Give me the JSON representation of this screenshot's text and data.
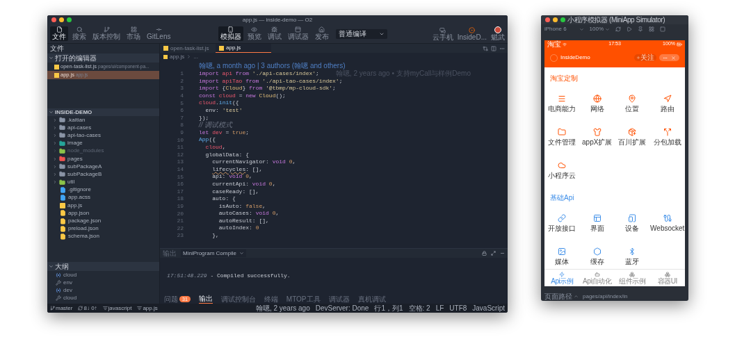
{
  "ide": {
    "title": "app.js — inside-demo — O2",
    "toolbar_left": [
      {
        "label": "文件",
        "selected": true
      },
      {
        "label": "搜索",
        "selected": false
      },
      {
        "label": "版本控制",
        "selected": false
      },
      {
        "label": "市场",
        "selected": false
      },
      {
        "label": "GitLens",
        "selected": false
      }
    ],
    "toolbar_center": [
      {
        "label": "模拟器",
        "selected": true
      },
      {
        "label": "预览",
        "selected": false
      },
      {
        "label": "调试",
        "selected": false
      },
      {
        "label": "调试器",
        "selected": false
      },
      {
        "label": "发布",
        "selected": false
      }
    ],
    "compile_mode": "普通编译",
    "toolbar_right": [
      {
        "label": "云手机"
      },
      {
        "label": "InsideD..."
      },
      {
        "label": "魈武"
      }
    ],
    "sidebar": {
      "title": "文件",
      "open_editors": {
        "title": "打开的编辑器",
        "expanded": true,
        "items": [
          {
            "name": "open-task-list.js",
            "path": "pages/ui/component-pa...",
            "selected": false
          },
          {
            "name": "app.js",
            "path": "app.js",
            "selected": true
          }
        ]
      },
      "project": {
        "title": "INSIDE-DEMO",
        "expanded": true,
        "items": [
          {
            "name": ".kaitian",
            "kind": "folder",
            "color": "#8a94a6",
            "ignored": false
          },
          {
            "name": "api-cases",
            "kind": "folder",
            "color": "#8a94a6",
            "ignored": false
          },
          {
            "name": "api-tao-cases",
            "kind": "folder",
            "color": "#8a94a6",
            "ignored": false
          },
          {
            "name": "image",
            "kind": "folder",
            "color": "#26a69a",
            "ignored": false
          },
          {
            "name": "node_modules",
            "kind": "folder",
            "color": "#8bc34a",
            "ignored": true
          },
          {
            "name": "pages",
            "kind": "folder",
            "color": "#ef5350",
            "ignored": false
          },
          {
            "name": "subPackageA",
            "kind": "folder",
            "color": "#8a94a6",
            "ignored": false
          },
          {
            "name": "subPackageB",
            "kind": "folder",
            "color": "#8a94a6",
            "ignored": false
          },
          {
            "name": "util",
            "kind": "folder",
            "color": "#8bc34a",
            "ignored": false
          },
          {
            "name": ".gitignore",
            "kind": "git",
            "color": "#42a5f5",
            "ignored": false
          },
          {
            "name": "app.acss",
            "kind": "css",
            "color": "#42a5f5",
            "ignored": false
          },
          {
            "name": "app.js",
            "kind": "js",
            "color": "#f9c846",
            "ignored": false
          },
          {
            "name": "app.json",
            "kind": "json",
            "color": "#f9c846",
            "ignored": false
          },
          {
            "name": "package.json",
            "kind": "json",
            "color": "#f9c846",
            "ignored": false
          },
          {
            "name": "preload.json",
            "kind": "json",
            "color": "#f9c846",
            "ignored": false
          },
          {
            "name": "schema.json",
            "kind": "json",
            "color": "#f9c846",
            "ignored": false
          }
        ]
      },
      "outline": {
        "title": "大纲",
        "expanded": true,
        "items": [
          {
            "name": "cloud",
            "kind": "variable"
          },
          {
            "name": "env",
            "kind": "property"
          },
          {
            "name": "dev",
            "kind": "variable"
          },
          {
            "name": "cloud",
            "kind": "property"
          }
        ]
      }
    },
    "editor": {
      "tabs": [
        {
          "label": "open-task-list.js",
          "selected": false
        },
        {
          "label": "app.js",
          "selected": true
        }
      ],
      "breadcrumb": [
        "app.js",
        "..."
      ],
      "blame": "翰嗯, a month ago | 3 authors (翰嗯 and others)",
      "inline_blame": "翰嗯, 2 years ago • 支持myCall与样例Demo",
      "lines": [
        {
          "n": "1",
          "tokens": [
            {
              "kind": "kw",
              "text": "import "
            },
            {
              "kind": "var",
              "text": "api "
            },
            {
              "kind": "kw",
              "text": "from "
            },
            {
              "kind": "str",
              "text": "'./api-cases/index'"
            },
            {
              "kind": "p",
              "text": ";"
            }
          ]
        },
        {
          "n": "2",
          "tokens": [
            {
              "kind": "kw",
              "text": "import "
            },
            {
              "kind": "var",
              "text": "apiTao "
            },
            {
              "kind": "kw",
              "text": "from "
            },
            {
              "kind": "str",
              "text": "'./api-tao-cases/index'"
            },
            {
              "kind": "p",
              "text": ";"
            }
          ]
        },
        {
          "n": "3",
          "tokens": [
            {
              "kind": "kw",
              "text": "import "
            },
            {
              "kind": "p",
              "text": "{"
            },
            {
              "kind": "cls",
              "text": "Cloud"
            },
            {
              "kind": "p",
              "text": "} "
            },
            {
              "kind": "kw",
              "text": "from "
            },
            {
              "kind": "str",
              "text": "'@tbmp/mp-cloud-sdk'"
            },
            {
              "kind": "p",
              "text": ";"
            }
          ]
        },
        {
          "n": "4",
          "tokens": [
            {
              "kind": "kw",
              "text": "const "
            },
            {
              "kind": "var",
              "text": "cloud "
            },
            {
              "kind": "p",
              "text": "= "
            },
            {
              "kind": "kw",
              "text": "new "
            },
            {
              "kind": "cls",
              "text": "Cloud"
            },
            {
              "kind": "p",
              "text": "();"
            }
          ]
        },
        {
          "n": "5",
          "tokens": [
            {
              "kind": "var",
              "text": "cloud"
            },
            {
              "kind": "p",
              "text": "."
            },
            {
              "kind": "fn",
              "text": "init"
            },
            {
              "kind": "p",
              "text": "({"
            }
          ]
        },
        {
          "n": "6",
          "tokens": [
            {
              "kind": "p",
              "text": "  env: "
            },
            {
              "kind": "str",
              "text": "'test'"
            }
          ]
        },
        {
          "n": "7",
          "tokens": [
            {
              "kind": "p",
              "text": "});"
            }
          ]
        },
        {
          "n": "8",
          "tokens": [
            {
              "kind": "cm",
              "text": "// 调试模式"
            }
          ]
        },
        {
          "n": "9",
          "tokens": [
            {
              "kind": "kw",
              "text": "let "
            },
            {
              "kind": "var",
              "text": "dev "
            },
            {
              "kind": "p",
              "text": "= "
            },
            {
              "kind": "bool",
              "text": "true"
            },
            {
              "kind": "p",
              "text": ";"
            }
          ]
        },
        {
          "n": "10",
          "tokens": [
            {
              "kind": "fn",
              "text": "App"
            },
            {
              "kind": "p",
              "text": "({"
            }
          ]
        },
        {
          "n": "11",
          "tokens": [
            {
              "kind": "var",
              "text": "  cloud"
            },
            {
              "kind": "p",
              "text": ","
            }
          ]
        },
        {
          "n": "12",
          "tokens": [
            {
              "kind": "p",
              "text": "  globalData: {"
            }
          ]
        },
        {
          "n": "13",
          "tokens": [
            {
              "kind": "p",
              "text": "    currentNavigator: "
            },
            {
              "kind": "kw",
              "text": "void "
            },
            {
              "kind": "num",
              "text": "0"
            },
            {
              "kind": "p",
              "text": ","
            }
          ]
        },
        {
          "n": "14",
          "tokens": [
            {
              "kind": "warn",
              "text": "    lifecycles"
            },
            {
              "kind": "p",
              "text": ": [],"
            }
          ]
        },
        {
          "n": "15",
          "tokens": [
            {
              "kind": "p",
              "text": "    api: "
            },
            {
              "kind": "kw",
              "text": "void "
            },
            {
              "kind": "num",
              "text": "0"
            },
            {
              "kind": "p",
              "text": ","
            }
          ]
        },
        {
          "n": "16",
          "tokens": [
            {
              "kind": "p",
              "text": "    currentApi: "
            },
            {
              "kind": "kw",
              "text": "void "
            },
            {
              "kind": "num",
              "text": "0"
            },
            {
              "kind": "p",
              "text": ","
            }
          ]
        },
        {
          "n": "17",
          "tokens": [
            {
              "kind": "p",
              "text": "    caseReady: [],"
            }
          ]
        },
        {
          "n": "18",
          "tokens": [
            {
              "kind": "p",
              "text": "    auto: {"
            }
          ]
        },
        {
          "n": "19",
          "tokens": [
            {
              "kind": "p",
              "text": "      isAuto: "
            },
            {
              "kind": "bool",
              "text": "false"
            },
            {
              "kind": "p",
              "text": ","
            }
          ]
        },
        {
          "n": "20",
          "tokens": [
            {
              "kind": "p",
              "text": "      autoCases: "
            },
            {
              "kind": "kw",
              "text": "void "
            },
            {
              "kind": "num",
              "text": "0"
            },
            {
              "kind": "p",
              "text": ","
            }
          ]
        },
        {
          "n": "21",
          "tokens": [
            {
              "kind": "p",
              "text": "      autoResult: [],"
            }
          ]
        },
        {
          "n": "22",
          "tokens": [
            {
              "kind": "p",
              "text": "      autoIndex: "
            },
            {
              "kind": "num",
              "text": "0"
            }
          ]
        },
        {
          "n": "23",
          "tokens": [
            {
              "kind": "p",
              "text": "    },"
            }
          ]
        }
      ]
    },
    "panel": {
      "label": "输出",
      "channel": "MiniProgram Compile",
      "log_time": "17:51:48.229",
      "log_message": "- Compiled successfully.",
      "tabs": [
        {
          "label": "问题",
          "badge": "31",
          "selected": false
        },
        {
          "label": "输出",
          "selected": true
        },
        {
          "label": "调试控制台",
          "selected": false
        },
        {
          "label": "终端",
          "selected": false
        },
        {
          "label": "MTOP工具",
          "selected": false
        },
        {
          "label": "调试器",
          "selected": false
        },
        {
          "label": "真机调试",
          "selected": false
        }
      ]
    },
    "status_bar": {
      "branch": "master",
      "sync": "8↓ 0↑",
      "language_mode": "javascript",
      "file": "app.js",
      "right": [
        "翰嗯, 2 years ago",
        "DevServer: Done",
        "行1，列1",
        "空格: 2",
        "LF",
        "UTF8",
        "JavaScript"
      ]
    }
  },
  "simulator": {
    "title": "小程序模拟器 (MiniApp Simulator)",
    "device": "iPhone 6",
    "zoom": "100%",
    "phone": {
      "carrier": "淘宝",
      "time": "17:53",
      "battery": "100%",
      "nav_title": "InsideDemo",
      "follow": "关注",
      "sections": [
        {
          "title": "淘宝定制",
          "kind": "custom",
          "items": [
            "电商能力",
            "网络",
            "位置",
            "路由",
            "文件管理",
            "appX扩展",
            "百川扩展",
            "分包加载",
            "小程序云"
          ]
        },
        {
          "title": "基础Api",
          "kind": "basic",
          "items": [
            "开放接口",
            "界面",
            "设备",
            "Websocket",
            "媒体",
            "缓存",
            "蓝牙"
          ]
        }
      ],
      "tabbar": [
        {
          "label": "Api示例",
          "selected": true
        },
        {
          "label": "Api自动化",
          "selected": false
        },
        {
          "label": "组件示例",
          "selected": false
        },
        {
          "label": "容器UI",
          "selected": false
        }
      ]
    },
    "path_label": "页面路径",
    "path": "pages/api/index/in"
  }
}
